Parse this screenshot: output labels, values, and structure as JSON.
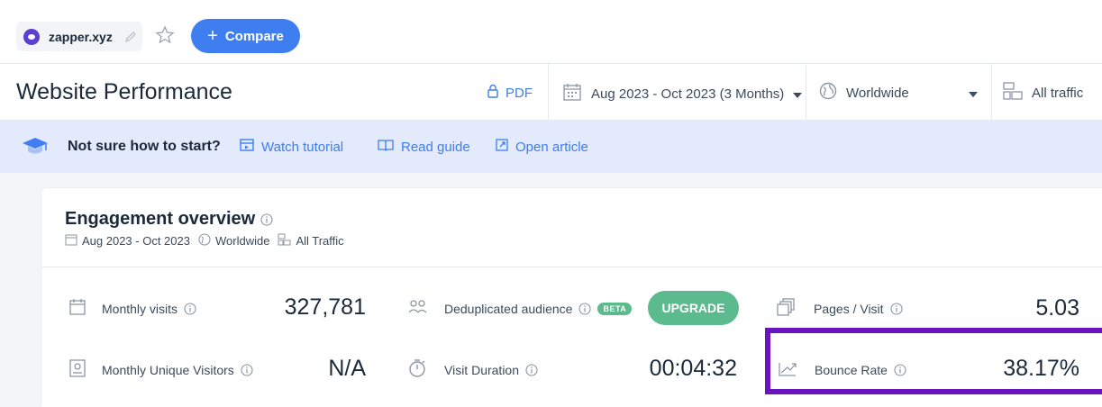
{
  "topbar": {
    "domain": "zapper.xyz",
    "compare_label": "Compare"
  },
  "header": {
    "title": "Website Performance",
    "pdf_label": "PDF",
    "date_range": "Aug 2023 - Oct 2023 (3 Months)",
    "geo": "Worldwide",
    "traffic": "All traffic"
  },
  "banner": {
    "title": "Not sure how to start?",
    "links": [
      "Watch tutorial",
      "Read guide",
      "Open article"
    ]
  },
  "card": {
    "title": "Engagement overview",
    "sub_date": "Aug 2023 - Oct 2023",
    "sub_geo": "Worldwide",
    "sub_traffic": "All Traffic",
    "metrics": {
      "monthly_visits": {
        "label": "Monthly visits",
        "value": "327,781"
      },
      "dedup": {
        "label": "Deduplicated audience",
        "badge": "BETA",
        "button": "UPGRADE"
      },
      "pages_visit": {
        "label": "Pages / Visit",
        "value": "5.03"
      },
      "unique_visitors": {
        "label": "Monthly Unique Visitors",
        "value": "N/A"
      },
      "visit_duration": {
        "label": "Visit Duration",
        "value": "00:04:32"
      },
      "bounce_rate": {
        "label": "Bounce Rate",
        "value": "38.17%"
      }
    }
  },
  "colors": {
    "accent": "#3f7ef0",
    "upgrade": "#5cba8f",
    "highlight": "#6a13bf",
    "banner_bg": "#e2eafb"
  }
}
